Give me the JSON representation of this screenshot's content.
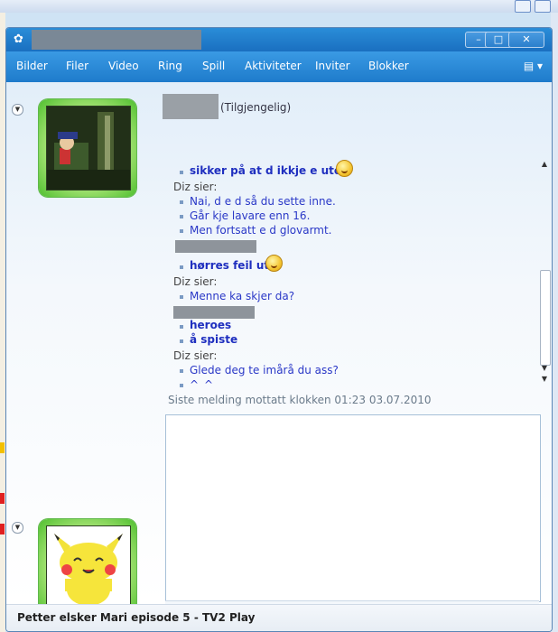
{
  "window": {
    "menu": [
      "Bilder",
      "Filer",
      "Video",
      "Ring",
      "Spill",
      "Aktiviteter",
      "Inviter",
      "Blokker"
    ]
  },
  "contact": {
    "status": "(Tilgjengelig)"
  },
  "conversation": {
    "messages": [
      {
        "text": "sikker på at d ikkje e ute?"
      },
      {
        "text": "Diz sier:"
      },
      {
        "text": "Nai, d e d så du sette inne."
      },
      {
        "text": "Går kje lavare  enn 16."
      },
      {
        "text": "Men fortsatt e d glovarmt."
      },
      {
        "text": "hørres feil ut"
      },
      {
        "text": "Diz sier:"
      },
      {
        "text": "Menne ka skjer da?"
      },
      {
        "text": "heroes"
      },
      {
        "text": "å spiste"
      },
      {
        "text": "Diz sier:"
      },
      {
        "text": "Glede deg te imårå du ass?"
      },
      {
        "text": "^_^"
      }
    ],
    "last_message": "Siste melding mottatt klokken 01:23 03.07.2010"
  },
  "statusbar": {
    "now_playing": "Petter elsker Mari episode 5 - TV2 Play"
  },
  "icons": {
    "app": "msn-icon",
    "smiley": "smiley-icon",
    "wink": "wink-icon",
    "nudge": "nudge-icon",
    "voice": "voice-clip-icon",
    "font": "font-icon",
    "background": "background-icon",
    "pen": "pen-icon",
    "text_a": "text-color-icon"
  },
  "colors": {
    "title_blue": "#1a6fc0",
    "message_blue": "#2a38c7",
    "avatar_green": "#4fbf2f"
  }
}
